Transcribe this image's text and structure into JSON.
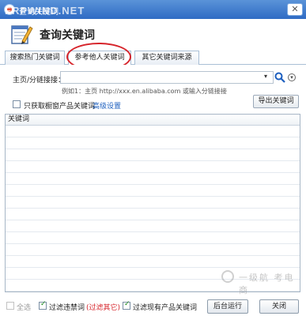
{
  "window": {
    "title": "查询关键词",
    "watermark": "FRPWIND.NET",
    "close_glyph": "✕"
  },
  "header": {
    "title": "查询关键词",
    "logo_icon": "notepad-pencil-icon"
  },
  "tabs": [
    {
      "label": "搜索热门关键词",
      "active": false
    },
    {
      "label": "参考他人关键词",
      "active": true
    },
    {
      "label": "其它关键词来源",
      "active": false
    }
  ],
  "form": {
    "url_label": "主页/分链接接：",
    "url_value": "",
    "dropdown_glyph": "▾",
    "example_text": "例如1：主页 http://xxx.en.alibaba.com 或输入分链接接",
    "only_tags_label": "只获取橱窗产品关键词",
    "advanced_link": "高级设置",
    "export_button": "导出关键词",
    "chevron_glyph": "▾"
  },
  "grid": {
    "column_header": "关键词",
    "rows": []
  },
  "footer": {
    "select_all_label": "全选",
    "filter_banned_label": "过滤违禁词",
    "filter_banned_link": "(过滤其它)",
    "filter_existing_label": "过滤现有产品关键词",
    "run_background_button": "后台运行",
    "close_button": "关闭",
    "filter_banned_checked": true,
    "filter_existing_checked": true,
    "select_all_checked": false
  },
  "watermark_bottom": "一级航 考电商",
  "colors": {
    "titlebar": "#2f6bc4",
    "highlight_ring": "#d6232a",
    "link": "#1d5fbf"
  }
}
